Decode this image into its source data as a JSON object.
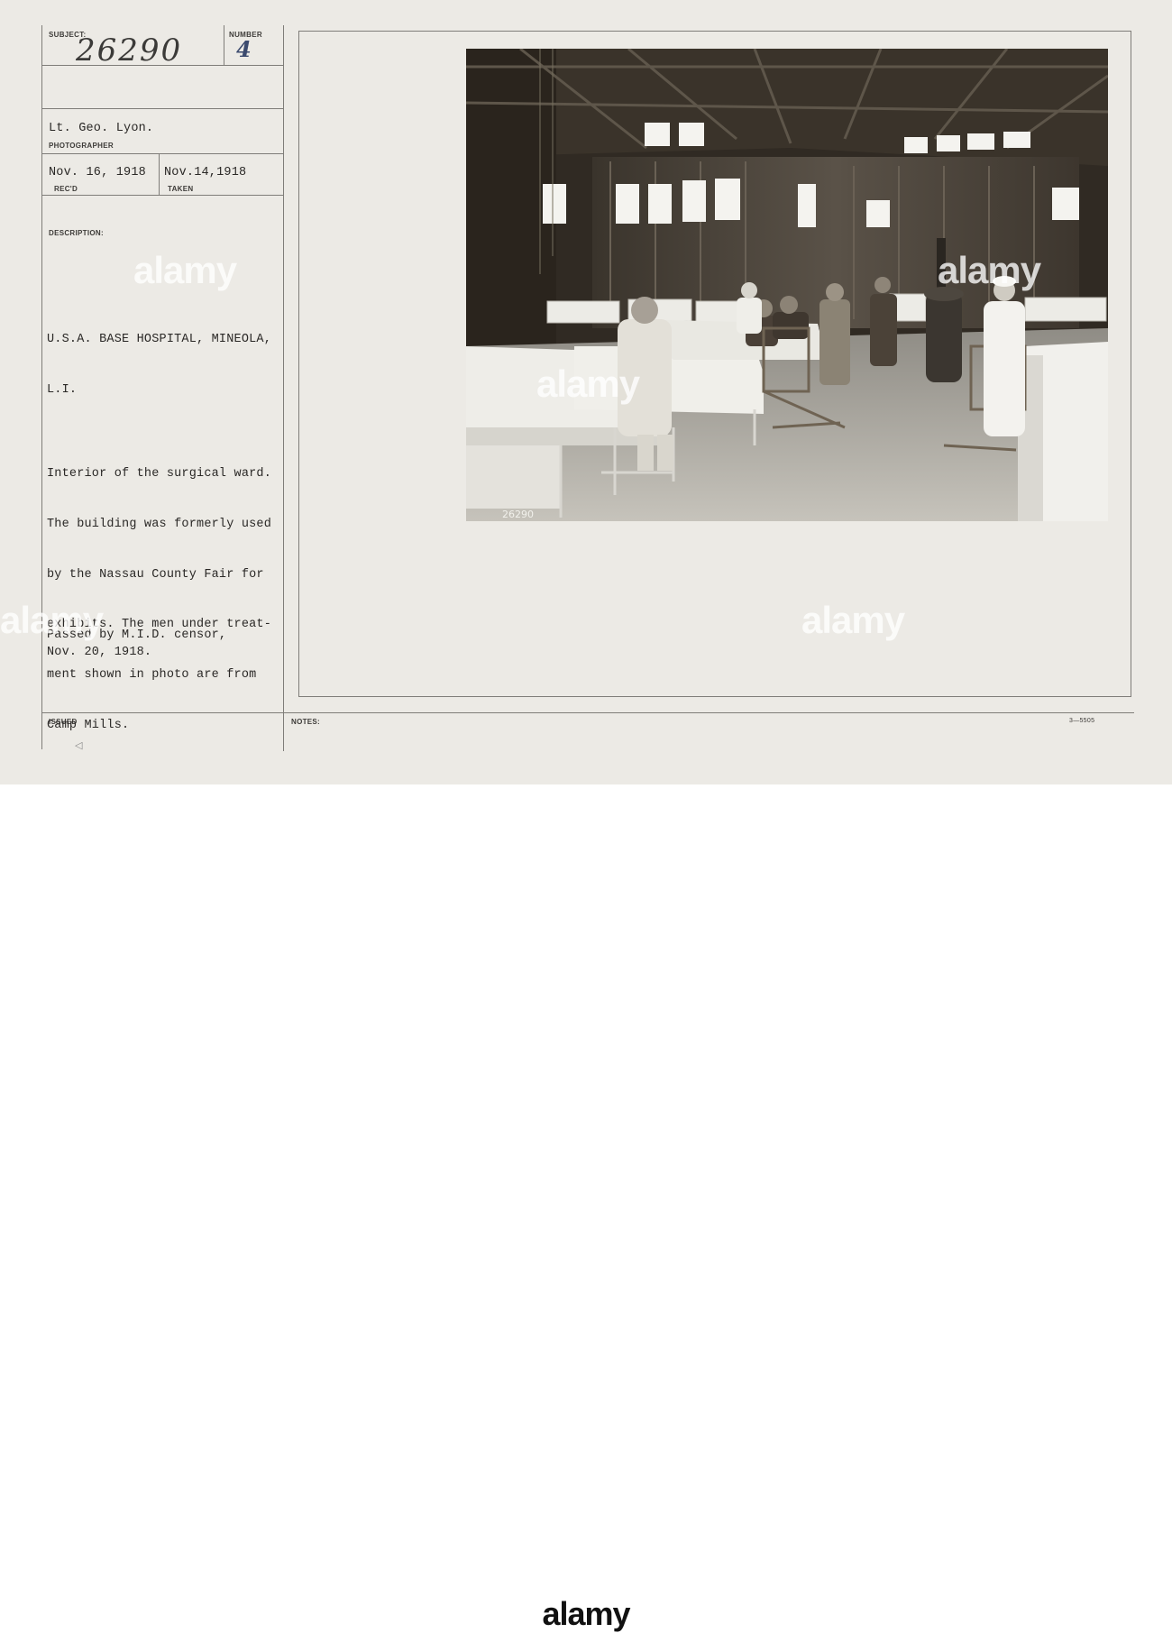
{
  "record": {
    "subject_label": "SUBJECT:",
    "subject_number": "26290",
    "number_label": "NUMBER",
    "number_value": "4",
    "photographer": "Lt. Geo. Lyon.",
    "photographer_label": "PHOTOGRAPHER",
    "received_date": "Nov. 16, 1918",
    "received_label": "REC'D",
    "taken_date": "Nov.14,1918",
    "taken_label": "TAKEN",
    "description_label": "DESCRIPTION:",
    "description_lines": [
      "U.S.A. BASE HOSPITAL, MINEOLA,",
      "L.I.",
      "",
      "Interior of the surgical ward.",
      "The building was formerly used",
      "by the Nassau County Fair for",
      "exhibits. The men under treat-",
      "ment shown in photo are from",
      "Camp Mills."
    ],
    "censor_line1": "Passed by M.I.D. censor,",
    "censor_line2": "Nov. 20, 1918.",
    "issued_label": "ISSUED",
    "notes_label": "NOTES:",
    "form_code": "3—5505",
    "photo_negative_number": "26290"
  },
  "watermark": {
    "text": "alamy"
  },
  "footer": {
    "left_text": "",
    "logo_text": "alamy",
    "right_text": ""
  },
  "colors": {
    "card_background": "#eceae5",
    "rule_lines": "#7f7d79",
    "typed_text": "#2a2826"
  }
}
